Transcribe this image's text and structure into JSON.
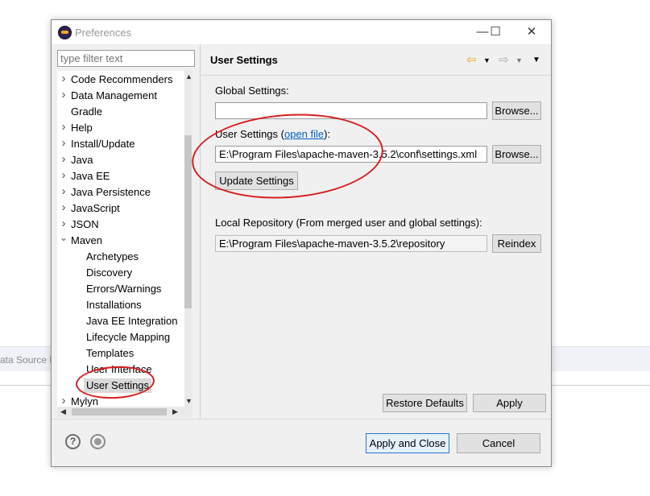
{
  "background": {
    "partial_text": "ata Source E"
  },
  "dialog": {
    "title": "Preferences",
    "window_buttons": {
      "minimize": "—",
      "maximize": "☐",
      "close": "✕"
    }
  },
  "filter": {
    "placeholder": "type filter text"
  },
  "tree": {
    "items": [
      {
        "label": "Code Recommenders",
        "chevron": "›"
      },
      {
        "label": "Data Management",
        "chevron": "›"
      },
      {
        "label": "Gradle",
        "chevron": ""
      },
      {
        "label": "Help",
        "chevron": "›"
      },
      {
        "label": "Install/Update",
        "chevron": "›"
      },
      {
        "label": "Java",
        "chevron": "›"
      },
      {
        "label": "Java EE",
        "chevron": "›"
      },
      {
        "label": "Java Persistence",
        "chevron": "›"
      },
      {
        "label": "JavaScript",
        "chevron": "›"
      },
      {
        "label": "JSON",
        "chevron": "›"
      },
      {
        "label": "Maven",
        "chevron": "⌄"
      },
      {
        "label": "Archetypes"
      },
      {
        "label": "Discovery"
      },
      {
        "label": "Errors/Warnings"
      },
      {
        "label": "Installations"
      },
      {
        "label": "Java EE Integration"
      },
      {
        "label": "Lifecycle Mapping"
      },
      {
        "label": "Templates"
      },
      {
        "label": "User Interface"
      },
      {
        "label": "User Settings",
        "selected": true
      },
      {
        "label": "Mylyn",
        "chevron": "›"
      }
    ]
  },
  "page": {
    "title": "User Settings",
    "global_settings_label": "Global Settings:",
    "global_settings_value": "",
    "user_settings_label": "User Settings (",
    "user_settings_link": "open file",
    "user_settings_label_end": "):",
    "user_settings_value": "E:\\Program Files\\apache-maven-3.5.2\\conf\\settings.xml",
    "update_settings_button": "Update Settings",
    "local_repo_label": "Local Repository (From merged user and global settings):",
    "local_repo_value": "E:\\Program Files\\apache-maven-3.5.2\\repository",
    "browse_button": "Browse...",
    "reindex_button": "Reindex",
    "restore_defaults_button": "Restore Defaults",
    "apply_button": "Apply"
  },
  "footer": {
    "help_glyph": "?",
    "apply_close_button": "Apply and Close",
    "cancel_button": "Cancel"
  },
  "colors": {
    "annotation": "#d81e1e",
    "link": "#0060c0",
    "nav_back": "#e8a21b"
  }
}
